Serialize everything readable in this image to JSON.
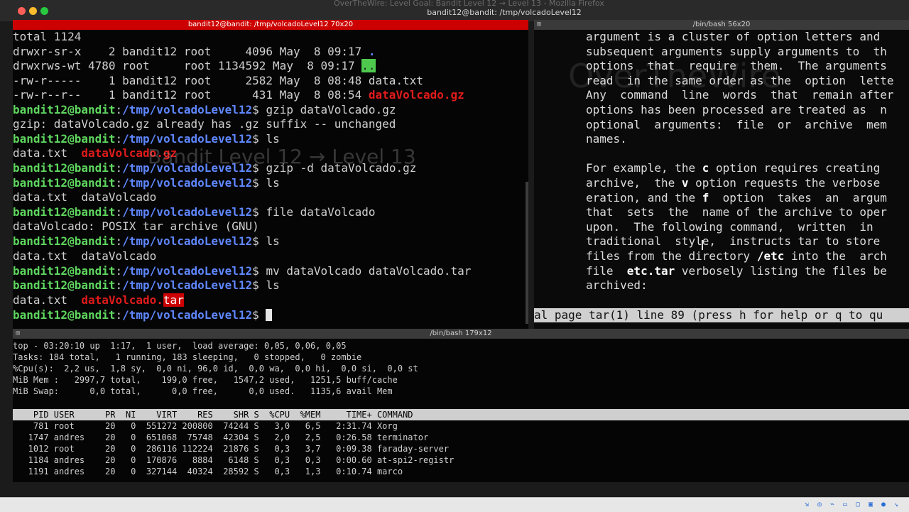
{
  "window": {
    "title": "bandit12@bandit: /tmp/volcadoLevel12",
    "background_app_title": "OverTheWire: Level Goal: Bandit Level 12 → Level 13 - Mozilla Firefox"
  },
  "left_pane": {
    "title": "bandit12@bandit: /tmp/volcadoLevel12 70x20",
    "prompt_user": "bandit12@bandit",
    "prompt_sep": ":",
    "prompt_path": "/tmp/volcadoLevel12",
    "prompt_sign": "$ ",
    "listing": {
      "total": "total 1124",
      "row1": "drwxr-sr-x    2 bandit12 root     4096 May  8 09:17 ",
      "row1_name": ".",
      "row2": "drwxrws-wt 4780 root     root 1134592 May  8 09:17 ",
      "row2_name": "..",
      "row3": "-rw-r-----    1 bandit12 root     2582 May  8 08:48 ",
      "row3_name": "data.txt",
      "row4": "-rw-r--r--    1 bandit12 root      431 May  8 08:54 ",
      "row4_name": "dataVolcado.gz"
    },
    "cmd1": "gzip dataVolcado.gz",
    "out1": "gzip: dataVolcado.gz already has .gz suffix -- unchanged",
    "cmd2": "ls",
    "out2_a": "data.txt  ",
    "out2_b": "dataVolcado.gz",
    "cmd3": "gzip -d dataVolcado.gz",
    "cmd4": "ls",
    "out4": "data.txt  dataVolcado",
    "cmd5": "file dataVolcado",
    "out5": "dataVolcado: POSIX tar archive (GNU)",
    "cmd6": "ls",
    "out6": "data.txt  dataVolcado",
    "cmd7": "mv dataVolcado dataVolcado.tar",
    "cmd8": "ls",
    "out8_a": "data.txt  ",
    "out8_b": "dataVolcado.",
    "out8_c": "tar"
  },
  "right_pane": {
    "title": "/bin/bash 56x20",
    "lines": [
      "argument is a cluster of option letters and",
      "subsequent arguments supply arguments to  th",
      "options  that  require  them.  The arguments",
      "read  in the same order as the  option  lette",
      "Any  command  line  words  that  remain after",
      "options has been processed are treated as  n",
      "optional  arguments:  file  or  archive  mem",
      "names."
    ],
    "para2": [
      {
        "pre": "For example, the ",
        "bold": "c",
        "post": " option requires creating"
      },
      {
        "pre": "archive,  the ",
        "bold": "v",
        "post": " option requests the verbose"
      },
      {
        "pre": "eration, and the ",
        "bold": "f",
        "post": "  option  takes  an  argum"
      },
      {
        "pre": "that  sets  the  name of the archive to oper",
        "bold": "",
        "post": ""
      },
      {
        "pre": "upon.  The following command,  written  in",
        "bold": "",
        "post": ""
      },
      {
        "pre": "traditional  style,  instructs tar to store",
        "bold": "",
        "post": ""
      },
      {
        "pre": "files from the directory ",
        "bold": "/etc",
        "post": " into the  arch"
      },
      {
        "pre": "file  ",
        "bold": "etc.tar",
        "post": " verbosely listing the files be"
      },
      {
        "pre": "archived:",
        "bold": "",
        "post": ""
      }
    ],
    "status": "al page tar(1) line 89 (press h for help or q to qu"
  },
  "bottom_pane": {
    "title": "/bin/bash 179x12",
    "top_lines": [
      "top - 03:20:10 up  1:17,  1 user,  load average: 0,05, 0,06, 0,05",
      "Tasks: 184 total,   1 running, 183 sleeping,   0 stopped,   0 zombie",
      "%Cpu(s):  2,2 us,  1,8 sy,  0,0 ni, 96,0 id,  0,0 wa,  0,0 hi,  0,0 si,  0,0 st",
      "MiB Mem :   2997,7 total,    199,0 free,   1547,2 used,   1251,5 buff/cache",
      "MiB Swap:      0,0 total,      0,0 free,      0,0 used.   1135,6 avail Mem"
    ],
    "header": "    PID USER      PR  NI    VIRT    RES    SHR S  %CPU  %MEM     TIME+ COMMAND",
    "processes": [
      "    781 root      20   0  551272 200800  74244 S   3,0   6,5   2:31.74 Xorg",
      "   1747 andres    20   0  651068  75748  42304 S   2,0   2,5   0:26.58 terminator",
      "   1012 root      20   0  286116 112224  21876 S   0,3   3,7   0:09.38 faraday-server",
      "   1184 andres    20   0  170876   8884   6148 S   0,3   0,3   0:00.60 at-spi2-registr",
      "   1191 andres    20   0  327144  40324  28592 S   0,3   1,3   0:10.74 marco"
    ]
  },
  "ghost": {
    "logo": "OverTheWire",
    "heading": "Bandit Level 12 → Level 13"
  },
  "colors": {
    "prompt_user": "#5fd75f",
    "prompt_path": "#5f87ff",
    "archive": "#e01b1b",
    "active_title": "#cc0000"
  }
}
